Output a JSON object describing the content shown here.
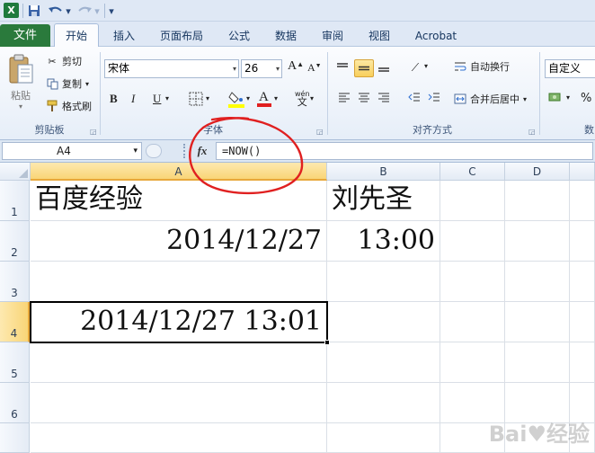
{
  "quick_access": {
    "logo": "X",
    "save_icon": "save-icon",
    "undo_icon": "undo-icon",
    "redo_icon": "redo-icon",
    "customize_icon": "customize-qat-icon"
  },
  "tabs": [
    "文件",
    "开始",
    "插入",
    "页面布局",
    "公式",
    "数据",
    "审阅",
    "视图",
    "Acrobat"
  ],
  "ribbon": {
    "clipboard": {
      "paste_label": "粘贴",
      "cut_label": "剪切",
      "copy_label": "复制",
      "format_painter_label": "格式刷",
      "group_label": "剪贴板"
    },
    "font": {
      "font_name": "宋体",
      "font_size": "26",
      "bold": "B",
      "italic": "I",
      "underline": "U",
      "grow": "A",
      "shrink": "A",
      "phonetic": "wén",
      "group_label": "字体"
    },
    "alignment": {
      "wrap_text_label": "自动换行",
      "merge_center_label": "合并后居中",
      "group_label": "对齐方式"
    },
    "number": {
      "format_value": "自定义",
      "percent": "%",
      "group_label": "数"
    }
  },
  "formula_bar": {
    "name_box": "A4",
    "fx_label": "fx",
    "formula": "=NOW()"
  },
  "sheet": {
    "columns": [
      "A",
      "B",
      "C",
      "D"
    ],
    "rows": [
      "1",
      "2",
      "3",
      "4",
      "5",
      "6"
    ],
    "cells": {
      "A1": "百度经验",
      "B1": "刘先圣",
      "A2": "2014/12/27",
      "B2": "13:00",
      "A4": "2014/12/27 13:01"
    },
    "selected_cell": "A4"
  },
  "colors": {
    "file_tab": "#2a7a3c",
    "selection_border": "#000000",
    "header_highlight": "#f9d577",
    "annotation_circle": "#e02020"
  }
}
